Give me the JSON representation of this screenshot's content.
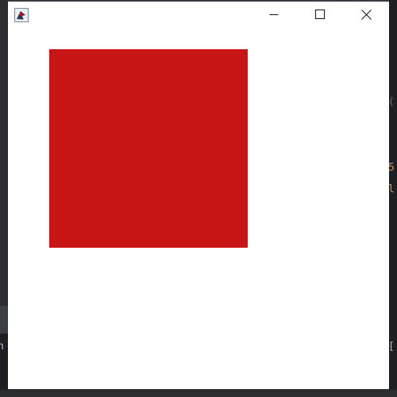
{
  "window": {
    "title": "",
    "app_icon": "java-duke-icon",
    "controls": {
      "minimize_icon": "minimize-icon",
      "maximize_icon": "maximize-icon",
      "close_icon": "close-icon"
    }
  },
  "canvas": {
    "background_color": "#ffffff",
    "shape": {
      "kind": "square",
      "fill_color": "#c81616"
    }
  },
  "background_ide": {
    "visible_fragments_right": [
      "(",
      "5",
      "l",
      "["
    ],
    "visible_fragments_left": [
      "n"
    ]
  }
}
